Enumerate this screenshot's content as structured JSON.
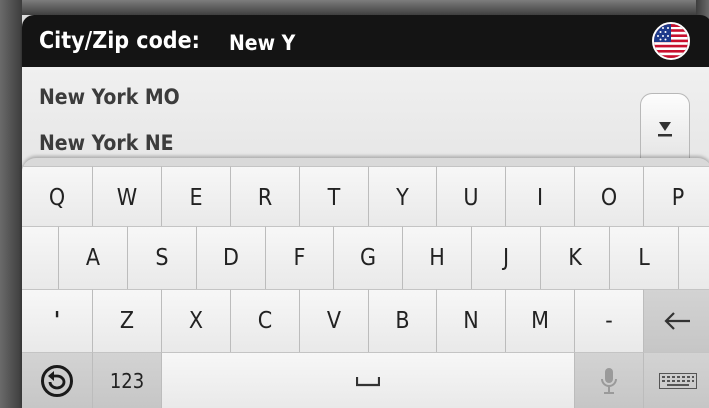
{
  "search": {
    "label": "City/Zip code:",
    "value": "New Y",
    "country_flag": "us-flag-icon"
  },
  "results": [
    {
      "label": "New York MO"
    },
    {
      "label": "New York NE"
    }
  ],
  "keyboard": {
    "row1": [
      "Q",
      "W",
      "E",
      "R",
      "T",
      "Y",
      "U",
      "I",
      "O",
      "P"
    ],
    "row2": [
      "A",
      "S",
      "D",
      "F",
      "G",
      "H",
      "J",
      "K",
      "L"
    ],
    "row3": [
      "'",
      "Z",
      "X",
      "C",
      "V",
      "B",
      "N",
      "M",
      "-"
    ],
    "numbers_label": "123",
    "icons": {
      "backspace": "backspace-arrow-icon",
      "back": "back-icon",
      "space": "space-icon",
      "microphone": "microphone-icon",
      "keyboard": "keyboard-icon",
      "scroll": "scroll-down-icon"
    }
  },
  "colors": {
    "header_bg": "#141414",
    "list_text": "#3c3c3c",
    "key_bg": "#f2f2f2",
    "special_key_bg": "#cbcbcb"
  }
}
